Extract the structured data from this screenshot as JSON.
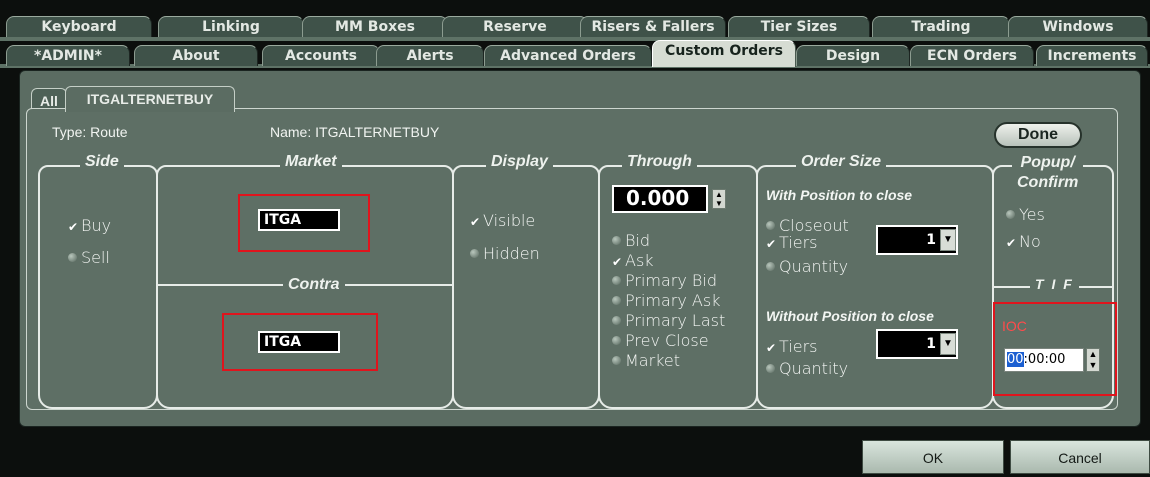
{
  "tabs_top": [
    "Keyboard",
    "Linking",
    "MM Boxes",
    "Reserve",
    "Risers & Fallers",
    "Tier Sizes",
    "Trading",
    "Windows"
  ],
  "tabs_bottom": [
    "*ADMIN*",
    "About",
    "Accounts",
    "Alerts",
    "Advanced Orders",
    "Custom Orders",
    "Design",
    "ECN Orders",
    "Increments"
  ],
  "active_tab": "Custom Orders",
  "subtabs": [
    "All",
    "ITGALTERNETBUY"
  ],
  "header": {
    "type_label": "Type: Route",
    "name_label": "Name: ITGALTERNETBUY",
    "done_label": "Done"
  },
  "side": {
    "title": "Side",
    "buy": "Buy",
    "sell": "Sell"
  },
  "market": {
    "title": "Market",
    "value": "ITGA",
    "contra_title": "Contra",
    "contra_value": "ITGA"
  },
  "display": {
    "title": "Display",
    "visible": "Visible",
    "hidden": "Hidden"
  },
  "through": {
    "title": "Through",
    "value": "0.000",
    "options": [
      "Bid",
      "Ask",
      "Primary Bid",
      "Primary Ask",
      "Primary Last",
      "Prev Close",
      "Market"
    ]
  },
  "order_size": {
    "title": "Order Size",
    "with_title": "With Position to close",
    "closeout": "Closeout",
    "tiers": "Tiers",
    "quantity": "Quantity",
    "with_value": "1",
    "without_title": "Without Position to close",
    "without_value": "1"
  },
  "popup": {
    "title_line1": "Popup/",
    "title_line2": "Confirm",
    "yes": "Yes",
    "no": "No"
  },
  "tif": {
    "title": "T I F",
    "type": "IOC",
    "hh": "00",
    "rest": ":00:00"
  },
  "buttons": {
    "ok": "OK",
    "cancel": "Cancel"
  }
}
